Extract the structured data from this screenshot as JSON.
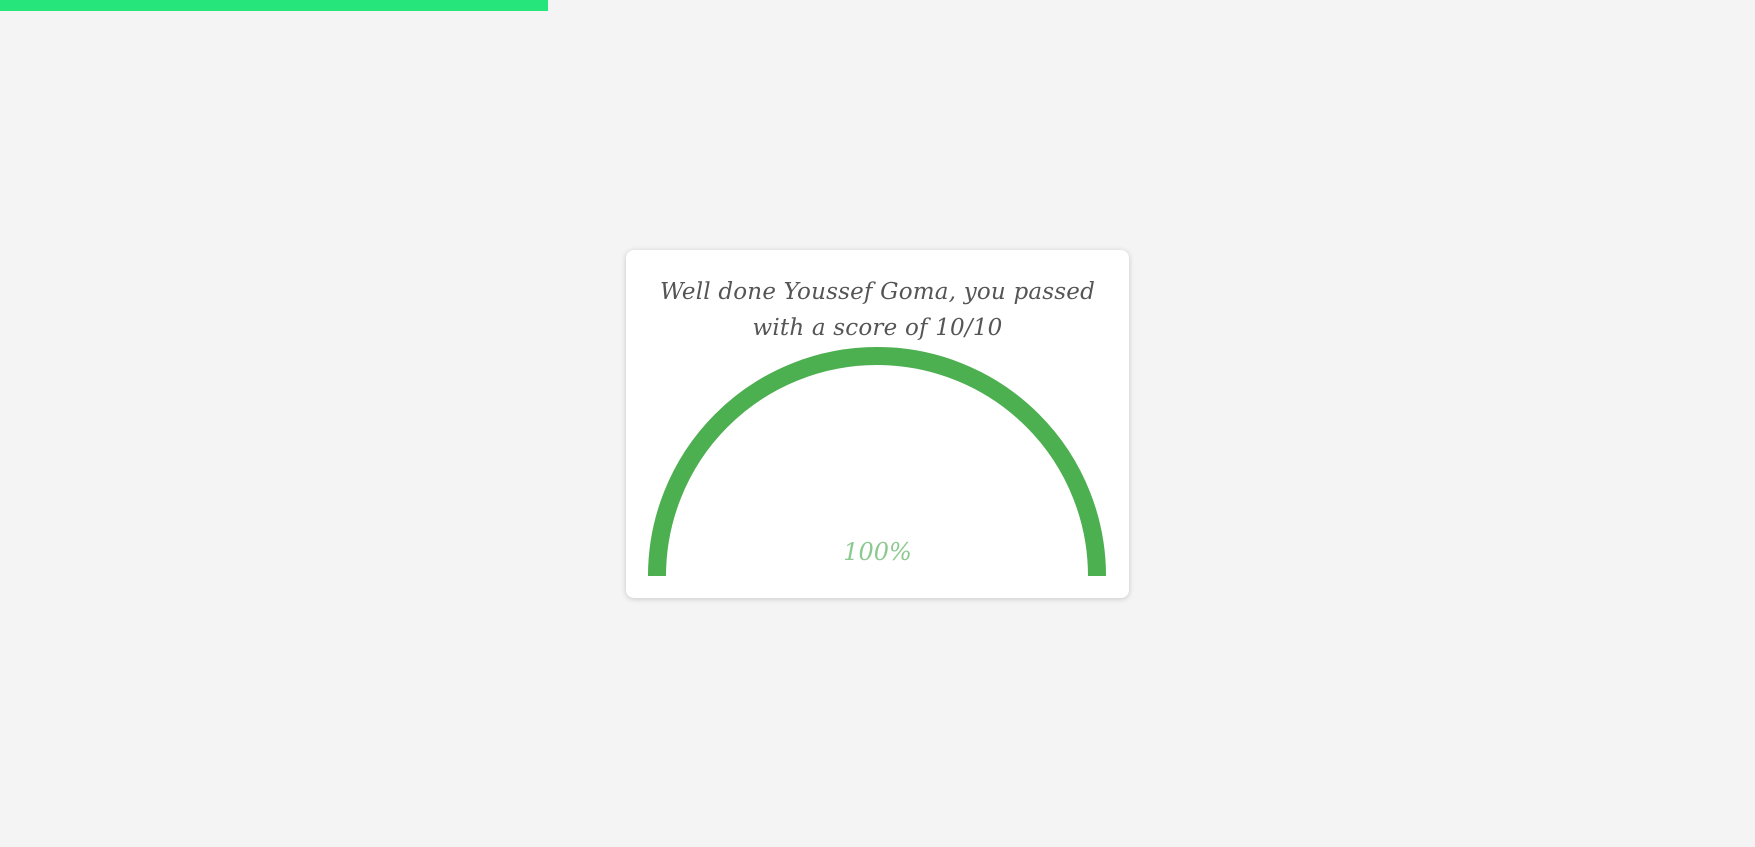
{
  "progress": {
    "fraction": 0.3125,
    "color": "#26e57a"
  },
  "result": {
    "message": "Well done Youssef Goma, you passed with a score of 10/10",
    "score_fraction": 1.0,
    "percent_label": "100%",
    "gauge_color": "#4caf50",
    "percent_color": "#8cc98f"
  }
}
